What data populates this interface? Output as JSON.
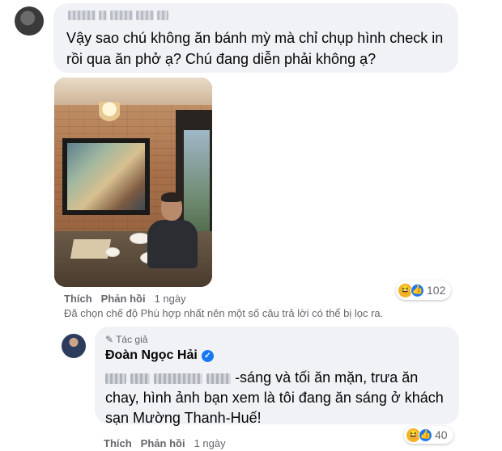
{
  "comment1": {
    "author_name_visible": "",
    "text": "Vậy sao chú không ăn bánh mỳ mà chỉ chụp hình check in rồi qua ăn phở ạ? Chú đang diễn phải không ạ?",
    "photo_alt": "",
    "actions": {
      "like": "Thích",
      "reply": "Phản hồi",
      "time": "1 ngày"
    },
    "reactions": {
      "icons": [
        "haha-icon",
        "like-icon"
      ],
      "count": "102"
    },
    "filter_note": "Đã chọn chế độ Phù hợp nhất nên một số câu trả lời có thể bị lọc ra."
  },
  "reply": {
    "author_badge": "Tác giả",
    "author_name": "Đoàn Ngọc Hải",
    "verified": true,
    "text_suffix": "-sáng và tối ăn mặn, trưa ăn chay, hình ảnh bạn xem là tôi đang ăn sáng ở khách sạn Mường Thanh-Huế!",
    "actions": {
      "like": "Thích",
      "reply": "Phản hồi",
      "time": "1 ngày"
    },
    "reactions": {
      "icons": [
        "haha-icon",
        "like-icon"
      ],
      "count": "40"
    }
  },
  "colors": {
    "bubble_bg": "#f0f2f5",
    "meta_text": "#65676b",
    "brand_blue": "#1877f2",
    "haha_yellow": "#f7b125"
  }
}
